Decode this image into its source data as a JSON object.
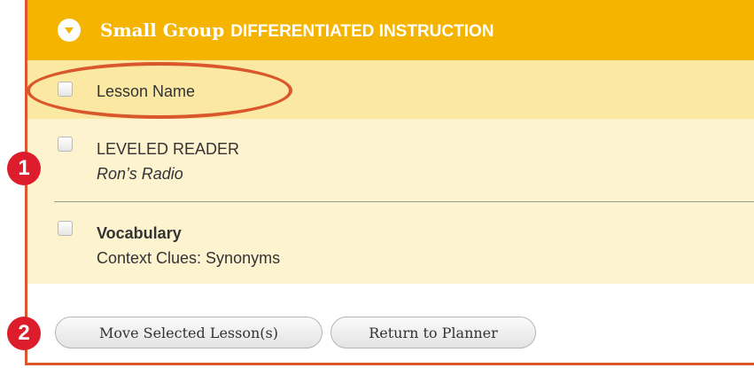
{
  "header": {
    "title_lead": "Small Group",
    "title_caps": "DIFFERENTIATED INSTRUCTION"
  },
  "columns": {
    "lesson_name": "Lesson Name"
  },
  "lessons": [
    {
      "title": "LEVELED READER",
      "subtitle": "Ron’s Radio"
    },
    {
      "title": "Vocabulary",
      "subtitle": "Context Clues: Synonyms"
    }
  ],
  "callouts": [
    "1",
    "2"
  ],
  "buttons": {
    "move": "Move Selected Lesson(s)",
    "return": "Return to Planner"
  },
  "colors": {
    "header": "#f4b400",
    "annotation": "#d9572b",
    "badge": "#dd1d2b"
  }
}
